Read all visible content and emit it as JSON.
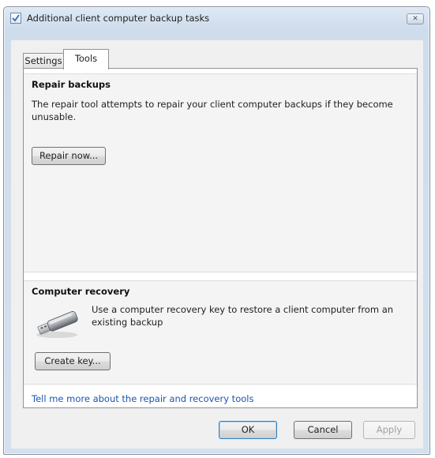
{
  "window": {
    "title": "Additional client computer backup tasks",
    "close_glyph": "✕"
  },
  "tabs": [
    {
      "label": "Settings",
      "selected": false
    },
    {
      "label": "Tools",
      "selected": true
    }
  ],
  "repair": {
    "heading": "Repair backups",
    "description": "The repair tool attempts to repair your client computer backups if they become unusable.",
    "button_label": "Repair now..."
  },
  "recovery": {
    "heading": "Computer recovery",
    "icon": "usb-key-icon",
    "description": "Use a computer recovery key to restore a client computer from an existing backup",
    "button_label": "Create key..."
  },
  "help_link": "Tell me more about the repair and recovery tools",
  "footer": {
    "ok_label": "OK",
    "cancel_label": "Cancel",
    "apply_label": "Apply",
    "apply_enabled": false
  },
  "colors": {
    "link": "#1a55b0",
    "window_chrome": "#d4e0ee",
    "dialog_background": "#f0f0f0"
  }
}
